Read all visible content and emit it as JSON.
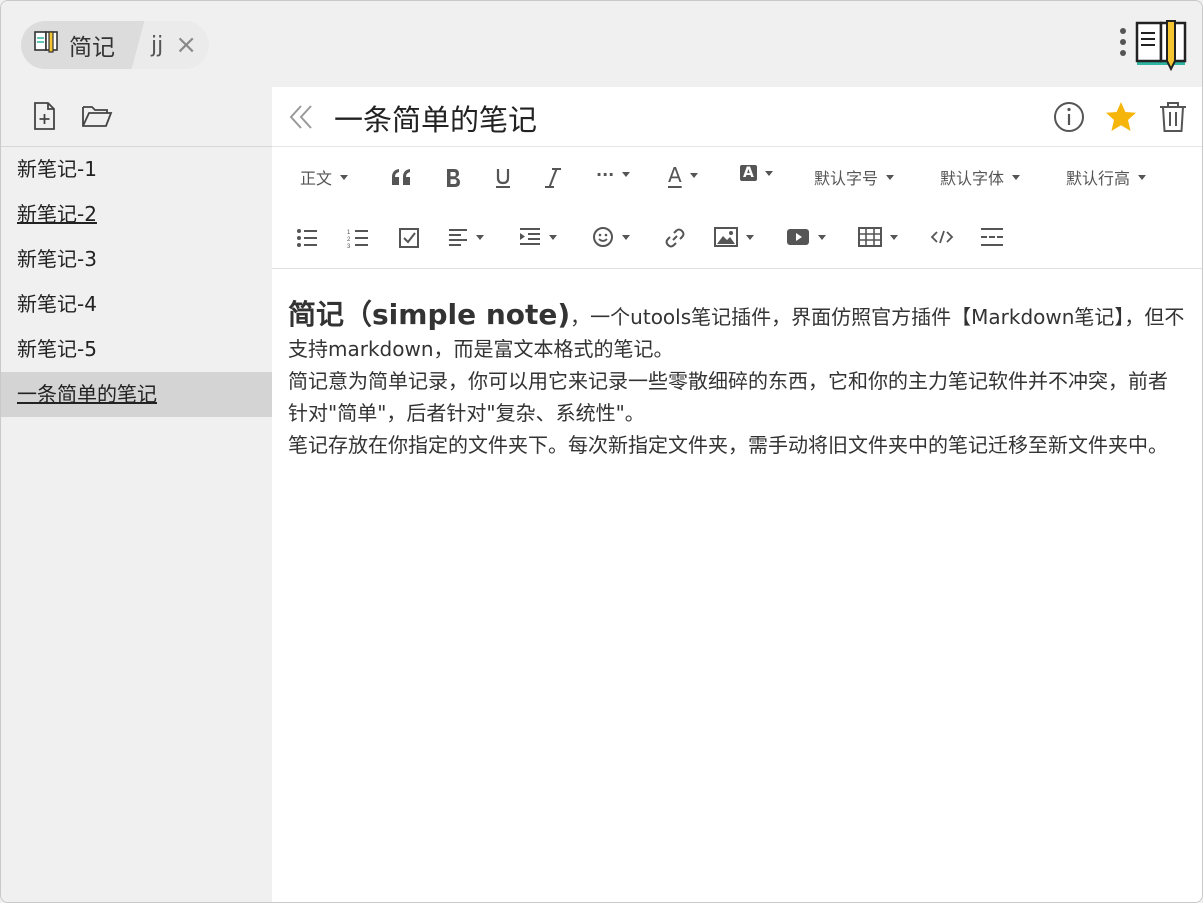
{
  "topbar": {
    "plugin_name": "简记",
    "sub_tab": "jj",
    "close_glyph": "×"
  },
  "sidebar": {
    "items": [
      {
        "label": "新笔记-1",
        "underlined": false,
        "active": false
      },
      {
        "label": "新笔记-2",
        "underlined": true,
        "active": false
      },
      {
        "label": "新笔记-3",
        "underlined": false,
        "active": false
      },
      {
        "label": "新笔记-4",
        "underlined": false,
        "active": false
      },
      {
        "label": "新笔记-5",
        "underlined": false,
        "active": false
      },
      {
        "label": "一条简单的笔记",
        "underlined": true,
        "active": true
      }
    ]
  },
  "editor": {
    "title": "一条简单的笔记",
    "toolbar": {
      "paragraph": "正文",
      "more": "···",
      "font_color": "A",
      "bg_color": "A",
      "font_size": "默认字号",
      "font_family": "默认字体",
      "line_height": "默认行高"
    },
    "content": {
      "heading": "简记（simple note)",
      "p1_rest": "，一个utools笔记插件，界面仿照官方插件【Markdown笔记】，但不支持markdown，而是富文本格式的笔记。",
      "p2": "简记意为简单记录，你可以用它来记录一些零散细碎的东西，它和你的主力笔记软件并不冲突，前者针对\"简单\"，后者针对\"复杂、系统性\"。",
      "p3": "笔记存放在你指定的文件夹下。每次新指定文件夹，需手动将旧文件夹中的笔记迁移至新文件夹中。"
    }
  },
  "colors": {
    "star": "#f5b50a",
    "logo_teal": "#2fb5a2",
    "logo_yellow": "#f4c531",
    "active_item_bg": "#d4d4d4"
  }
}
